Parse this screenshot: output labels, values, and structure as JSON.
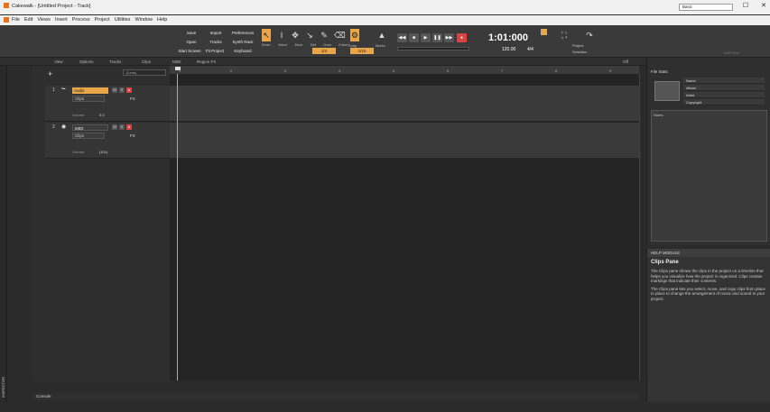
{
  "window": {
    "title": "Cakewalk - [Untitled Project - Track]",
    "preset": "Basic"
  },
  "menu": [
    "File",
    "Edit",
    "Views",
    "Insert",
    "Process",
    "Project",
    "Utilities",
    "Window",
    "Help"
  ],
  "toolbar": {
    "buttons": [
      "Save",
      "Import",
      "Preferences",
      "Open",
      "Tracks",
      "Synth Rack",
      "Start Screen",
      "Fit Project",
      "Keyboard"
    ],
    "tools": [
      "Smart",
      "Select",
      "Move",
      "Edit",
      "Draw",
      "Eraser"
    ],
    "snap_label": "Snap",
    "snap_value": "1/4",
    "marks_label": "Marks",
    "nudge_value": "1/16",
    "clock": "1:01:000",
    "tempo": "120.00",
    "meter": "4/4",
    "range_project": "Project",
    "range_selection": "Selection",
    "edit_filter": "Edit Filter"
  },
  "track_view_menu": [
    "View",
    "Options",
    "Tracks",
    "Clips",
    "MIDI",
    "Region FX"
  ],
  "zoom_level": "Off",
  "tracks": [
    {
      "number": "1",
      "name": "Audio",
      "mode": "Clips",
      "fx": "FX",
      "volume_label": "Volume",
      "volume": "0.0",
      "selected": true
    },
    {
      "number": "2",
      "name": "MIDI",
      "mode": "Clips",
      "fx": "FX",
      "volume_label": "Volume",
      "volume": "(101)",
      "selected": false
    }
  ],
  "track_filter": "(Lens)",
  "ruler_marks": [
    "1",
    "2",
    "3",
    "4",
    "5",
    "6",
    "7",
    "8",
    "9"
  ],
  "browser": {
    "tab": "Notes",
    "section": "File Stats",
    "fields": [
      "Name",
      "Album",
      "Artist",
      "Copyright"
    ],
    "notes_label": "Notes"
  },
  "help": {
    "header": "HELP MODULE",
    "title": "Clips Pane",
    "paragraph1": "The Clips pane shows the clips in the project on a timeline that helps you visualize how the project is organized. Clips contain markings that indicate their contents.",
    "paragraph2": "The Clips pane lets you select, move, and copy clips from place to place to change the arrangement of music and sound in your project."
  },
  "bottom_tab": "Console",
  "inspector_label": "INSPECTOR",
  "colors": {
    "accent": "#e8a54a",
    "record": "#d64545",
    "logo": "#e8731e"
  }
}
